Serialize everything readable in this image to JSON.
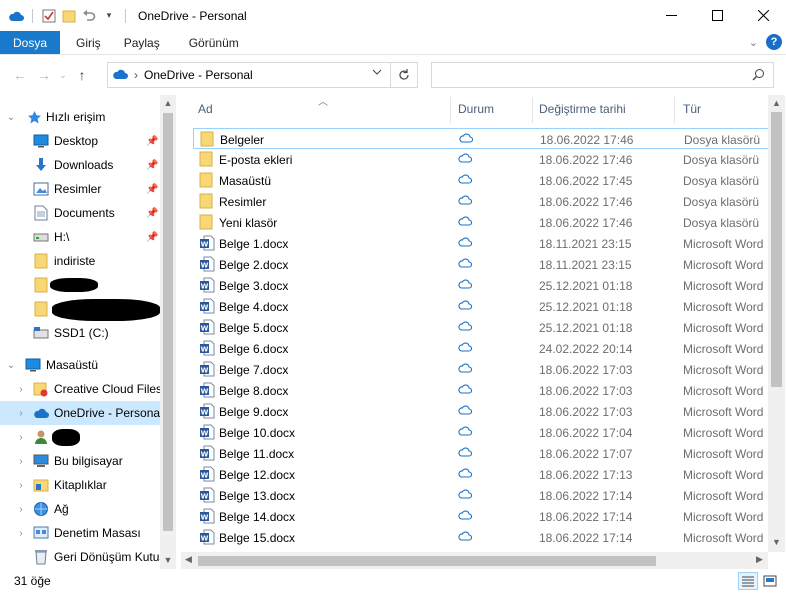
{
  "window": {
    "title": "OneDrive - Personal",
    "controls": [
      "minimize-icon",
      "maximize-icon",
      "close-icon"
    ]
  },
  "ribbon": {
    "tabs": [
      "Dosya",
      "Giriş",
      "Paylaş",
      "Görünüm"
    ]
  },
  "address": {
    "location": "OneDrive - Personal",
    "search_placeholder": ""
  },
  "nav": {
    "quick_access": "Hızlı erişim",
    "items": [
      {
        "label": "Desktop",
        "icon": "desktop-icon",
        "pinned": true
      },
      {
        "label": "Downloads",
        "icon": "downloads-icon",
        "pinned": true
      },
      {
        "label": "Resimler",
        "icon": "pictures-icon",
        "pinned": true
      },
      {
        "label": "Documents",
        "icon": "documents-icon",
        "pinned": true
      },
      {
        "label": "H:\\",
        "icon": "drive-icon",
        "pinned": true
      },
      {
        "label": "indiriste",
        "icon": "folder-icon",
        "pinned": false
      },
      {
        "label": "",
        "icon": "folder-icon",
        "pinned": false
      },
      {
        "label": "",
        "icon": "folder-icon",
        "pinned": false
      },
      {
        "label": "SSD1 (C:)",
        "icon": "drive-icon",
        "pinned": false
      }
    ],
    "desktop_root": "Masaüstü",
    "desktop_items": [
      {
        "label": "Creative Cloud Files",
        "icon": "creative-cloud-icon"
      },
      {
        "label": "OneDrive - Personal",
        "icon": "onedrive-icon",
        "selected": true
      },
      {
        "label": "",
        "icon": "user-icon"
      },
      {
        "label": "Bu bilgisayar",
        "icon": "computer-icon"
      },
      {
        "label": "Kitaplıklar",
        "icon": "libraries-icon"
      },
      {
        "label": "Ağ",
        "icon": "network-icon"
      },
      {
        "label": "Denetim Masası",
        "icon": "control-panel-icon"
      },
      {
        "label": "Geri Dönüşüm Kutusu",
        "icon": "recycle-bin-icon"
      }
    ]
  },
  "columns": [
    "Ad",
    "Durum",
    "Değiştirme tarihi",
    "Tür"
  ],
  "files": [
    {
      "name": "Belgeler",
      "kind": "folder",
      "date": "18.06.2022 17:46",
      "type": "Dosya klasörü"
    },
    {
      "name": "E-posta ekleri",
      "kind": "folder",
      "date": "18.06.2022 17:46",
      "type": "Dosya klasörü"
    },
    {
      "name": "Masaüstü",
      "kind": "folder",
      "date": "18.06.2022 17:45",
      "type": "Dosya klasörü"
    },
    {
      "name": "Resimler",
      "kind": "folder",
      "date": "18.06.2022 17:46",
      "type": "Dosya klasörü"
    },
    {
      "name": "Yeni klasör",
      "kind": "folder",
      "date": "18.06.2022 17:46",
      "type": "Dosya klasörü"
    },
    {
      "name": "Belge 1.docx",
      "kind": "word",
      "date": "18.11.2021 23:15",
      "type": "Microsoft Word"
    },
    {
      "name": "Belge 2.docx",
      "kind": "word",
      "date": "18.11.2021 23:15",
      "type": "Microsoft Word"
    },
    {
      "name": "Belge 3.docx",
      "kind": "word",
      "date": "25.12.2021 01:18",
      "type": "Microsoft Word"
    },
    {
      "name": "Belge 4.docx",
      "kind": "word",
      "date": "25.12.2021 01:18",
      "type": "Microsoft Word"
    },
    {
      "name": "Belge 5.docx",
      "kind": "word",
      "date": "25.12.2021 01:18",
      "type": "Microsoft Word"
    },
    {
      "name": "Belge 6.docx",
      "kind": "word",
      "date": "24.02.2022 20:14",
      "type": "Microsoft Word"
    },
    {
      "name": "Belge 7.docx",
      "kind": "word",
      "date": "18.06.2022 17:03",
      "type": "Microsoft Word"
    },
    {
      "name": "Belge 8.docx",
      "kind": "word",
      "date": "18.06.2022 17:03",
      "type": "Microsoft Word"
    },
    {
      "name": "Belge 9.docx",
      "kind": "word",
      "date": "18.06.2022 17:03",
      "type": "Microsoft Word"
    },
    {
      "name": "Belge 10.docx",
      "kind": "word",
      "date": "18.06.2022 17:04",
      "type": "Microsoft Word"
    },
    {
      "name": "Belge 11.docx",
      "kind": "word",
      "date": "18.06.2022 17:07",
      "type": "Microsoft Word"
    },
    {
      "name": "Belge 12.docx",
      "kind": "word",
      "date": "18.06.2022 17:13",
      "type": "Microsoft Word"
    },
    {
      "name": "Belge 13.docx",
      "kind": "word",
      "date": "18.06.2022 17:14",
      "type": "Microsoft Word"
    },
    {
      "name": "Belge 14.docx",
      "kind": "word",
      "date": "18.06.2022 17:14",
      "type": "Microsoft Word"
    },
    {
      "name": "Belge 15.docx",
      "kind": "word",
      "date": "18.06.2022 17:14",
      "type": "Microsoft Word"
    }
  ],
  "status": {
    "count": "31 öğe"
  },
  "colors": {
    "accent": "#1979ca",
    "selection": "#cce8ff",
    "folder": "#f8d775",
    "word": "#2b579a",
    "cloud": "#1a73c9"
  }
}
